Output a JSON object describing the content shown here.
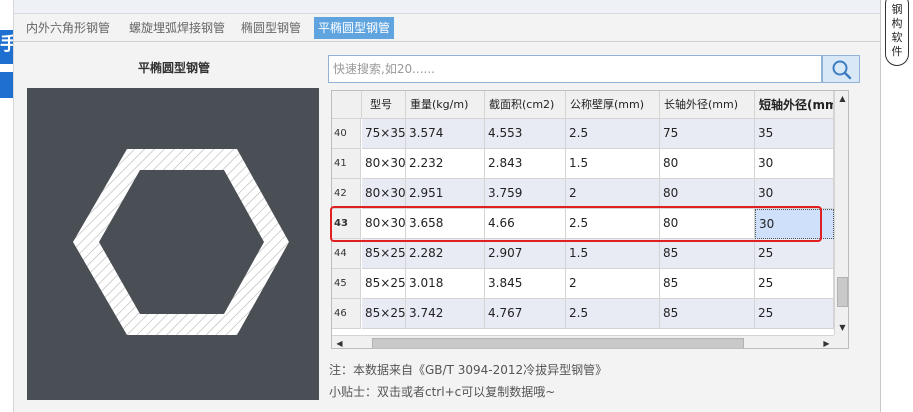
{
  "tabs": [
    {
      "label": "内外六角形钢管",
      "active": false
    },
    {
      "label": "螺旋埋弧焊接钢管",
      "active": false
    },
    {
      "label": "椭圆型钢管",
      "active": false
    },
    {
      "label": "平椭圆型钢管",
      "active": true
    }
  ],
  "figure": {
    "title": "平椭圆型钢管"
  },
  "search": {
    "placeholder": "快速搜索,如20......",
    "value": ""
  },
  "table": {
    "columns": [
      "",
      "型号",
      "重量(kg/m)",
      "截面积(cm2)",
      "公称壁厚(mm)",
      "长轴外径(mm)",
      "短轴外径(mm)"
    ],
    "rows": [
      {
        "index": "40",
        "cells": [
          "75×35",
          "3.574",
          "4.553",
          "2.5",
          "75",
          "35"
        ]
      },
      {
        "index": "41",
        "cells": [
          "80×30",
          "2.232",
          "2.843",
          "1.5",
          "80",
          "30"
        ]
      },
      {
        "index": "42",
        "cells": [
          "80×30",
          "2.951",
          "3.759",
          "2",
          "80",
          "30"
        ]
      },
      {
        "index": "43",
        "cells": [
          "80×30",
          "3.658",
          "4.66",
          "2.5",
          "80",
          "30"
        ],
        "selected": true
      },
      {
        "index": "44",
        "cells": [
          "85×25",
          "2.282",
          "2.907",
          "1.5",
          "85",
          "25"
        ]
      },
      {
        "index": "45",
        "cells": [
          "85×25",
          "3.018",
          "3.845",
          "2",
          "85",
          "25"
        ]
      },
      {
        "index": "46",
        "cells": [
          "85×25",
          "3.742",
          "4.767",
          "2.5",
          "85",
          "25"
        ]
      }
    ]
  },
  "notes": {
    "source": "注：本数据来自《GB/T 3094-2012冷拔异型钢管》",
    "tip": "小贴士：双击或者ctrl+c可以复制数据哦~"
  },
  "background": {
    "left_glyph": "手",
    "side_badge": "钢构软件"
  },
  "colors": {
    "active_tab": "#5fa4df",
    "figure_bg": "#4a4e55",
    "selection_border": "#e02020",
    "alt_row": "#e8eaf4"
  },
  "icons": {
    "search": "search-icon"
  }
}
